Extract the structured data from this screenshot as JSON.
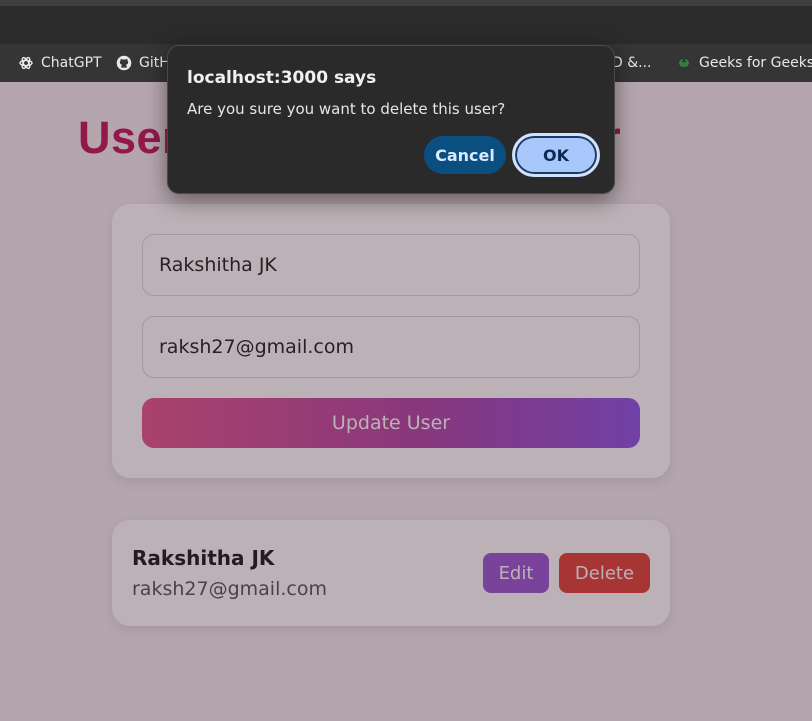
{
  "bookmarks": [
    {
      "label": "ChatGPT",
      "icon": "chatgpt-icon"
    },
    {
      "label": "GitH",
      "icon": "github-icon"
    },
    {
      "label": "D &...",
      "icon": ""
    },
    {
      "label": "Geeks for Geeks",
      "icon": "geeksforgeeks-icon"
    }
  ],
  "page": {
    "heading_left": "User",
    "heading_right": "ucer"
  },
  "form": {
    "name_value": "Rakshitha JK",
    "email_value": "raksh27@gmail.com",
    "submit_label": "Update User"
  },
  "user": {
    "name": "Rakshitha JK",
    "email": "raksh27@gmail.com",
    "edit_label": "Edit",
    "delete_label": "Delete"
  },
  "dialog": {
    "title": "localhost:3000 says",
    "message": "Are you sure you want to delete this user?",
    "cancel_label": "Cancel",
    "ok_label": "OK"
  },
  "colors": {
    "heading": "#c2185b",
    "edit_button": "#9b59d6",
    "delete_button": "#e0443a",
    "dialog_background": "#2a2a2a",
    "cancel_button": "#0b4f80",
    "ok_button": "#a8c8fb"
  }
}
